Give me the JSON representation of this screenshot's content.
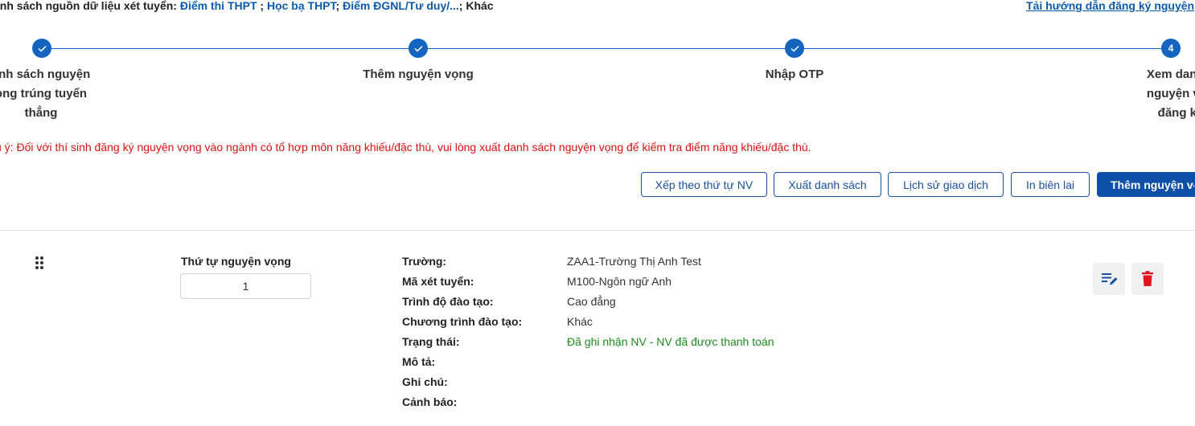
{
  "source_line": {
    "prefix": "anh sách nguồn dữ liệu xét tuyển: ",
    "sources": [
      {
        "label": "Điểm thi THPT",
        "sep": " ; "
      },
      {
        "label": "Học bạ THPT",
        "sep": "; "
      },
      {
        "label": "Điểm ĐGNL/Tư duy/...",
        "sep": "; "
      }
    ],
    "suffix": "Khác"
  },
  "guide_link": "Tải hướng dẫn đăng ký nguyện",
  "steps": [
    {
      "label": "anh sách nguyện\nọng trúng tuyển\nthẳng",
      "state": "done",
      "number": ""
    },
    {
      "label": "Thêm nguyện vọng",
      "state": "done",
      "number": ""
    },
    {
      "label": "Nhập OTP",
      "state": "done",
      "number": ""
    },
    {
      "label": "Xem danh s\nnguyện vọn\nđăng ký",
      "state": "current",
      "number": "4"
    }
  ],
  "note": "u ý: Đối với thí sinh đăng ký nguyện vọng vào ngành có tổ hợp môn năng khiếu/đặc thù, vui lòng xuất danh sách nguyện vọng để kiểm tra điểm năng khiếu/đặc thù.",
  "toolbar": {
    "sort_label": "Xếp theo thứ tự NV",
    "export_label": "Xuất danh sách",
    "history_label": "Lịch sử giao dịch",
    "receipt_label": "In biên lai",
    "add_label": "Thêm nguyện vọ"
  },
  "wish": {
    "order_label": "Thứ tự nguyện vọng",
    "order_value": "1",
    "fields": [
      {
        "label": "Trường:",
        "value": "ZAA1-Trường Thị Anh Test"
      },
      {
        "label": "Mã xét tuyển:",
        "value": "M100-Ngôn ngữ Anh"
      },
      {
        "label": "Trình độ đào tạo:",
        "value": "Cao đẳng"
      },
      {
        "label": "Chương trình đào tạo:",
        "value": "Khác"
      },
      {
        "label": "Trạng thái:",
        "value": "Đã ghi nhận NV - NV đã được thanh toán"
      },
      {
        "label": "Mô tả:",
        "value": ""
      },
      {
        "label": "Ghi chú:",
        "value": ""
      },
      {
        "label": "Cảnh báo:",
        "value": ""
      }
    ]
  },
  "icons": {
    "drag": "drag-handle-icon",
    "edit": "edit-list-icon",
    "delete": "trash-icon",
    "done": "check-icon"
  },
  "colors": {
    "primary": "#0e4fa8",
    "link": "#0d5cab",
    "warning_text": "#dd1111",
    "status_ok": "#1e8a1e",
    "delete": "#e0141e"
  }
}
